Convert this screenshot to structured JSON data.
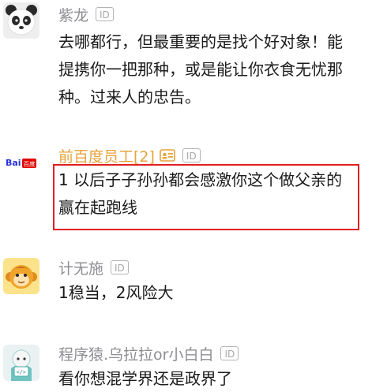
{
  "comments": [
    {
      "username": "紫龙",
      "id_badge": "ID",
      "avatar": "panda-avatar",
      "content": "去哪都行，但最重要的是找个好对象！能提携你一把那种，或是能让你衣食无忧那种。过来人的忠告。"
    },
    {
      "username": "前百度员工[2]",
      "id_badge": "ID",
      "avatar": "baidu-logo-avatar",
      "avatar_text": "Bai百度",
      "content": "1  以后子子孙孙都会感激你这个做父亲的  赢在起跑线",
      "highlighted": true
    },
    {
      "username": "计无施",
      "id_badge": "ID",
      "avatar": "monkey-avatar",
      "content": "1稳当，2风险大"
    },
    {
      "username": "程序猿.乌拉拉or小白白",
      "id_badge": "ID",
      "avatar": "coder-avatar",
      "content": "看你想混学界还是政界了"
    }
  ],
  "colors": {
    "username_gray": "#8e8e93",
    "username_highlight": "#e8a23a",
    "text": "#1b1b1b",
    "highlight_border": "#e02020"
  }
}
